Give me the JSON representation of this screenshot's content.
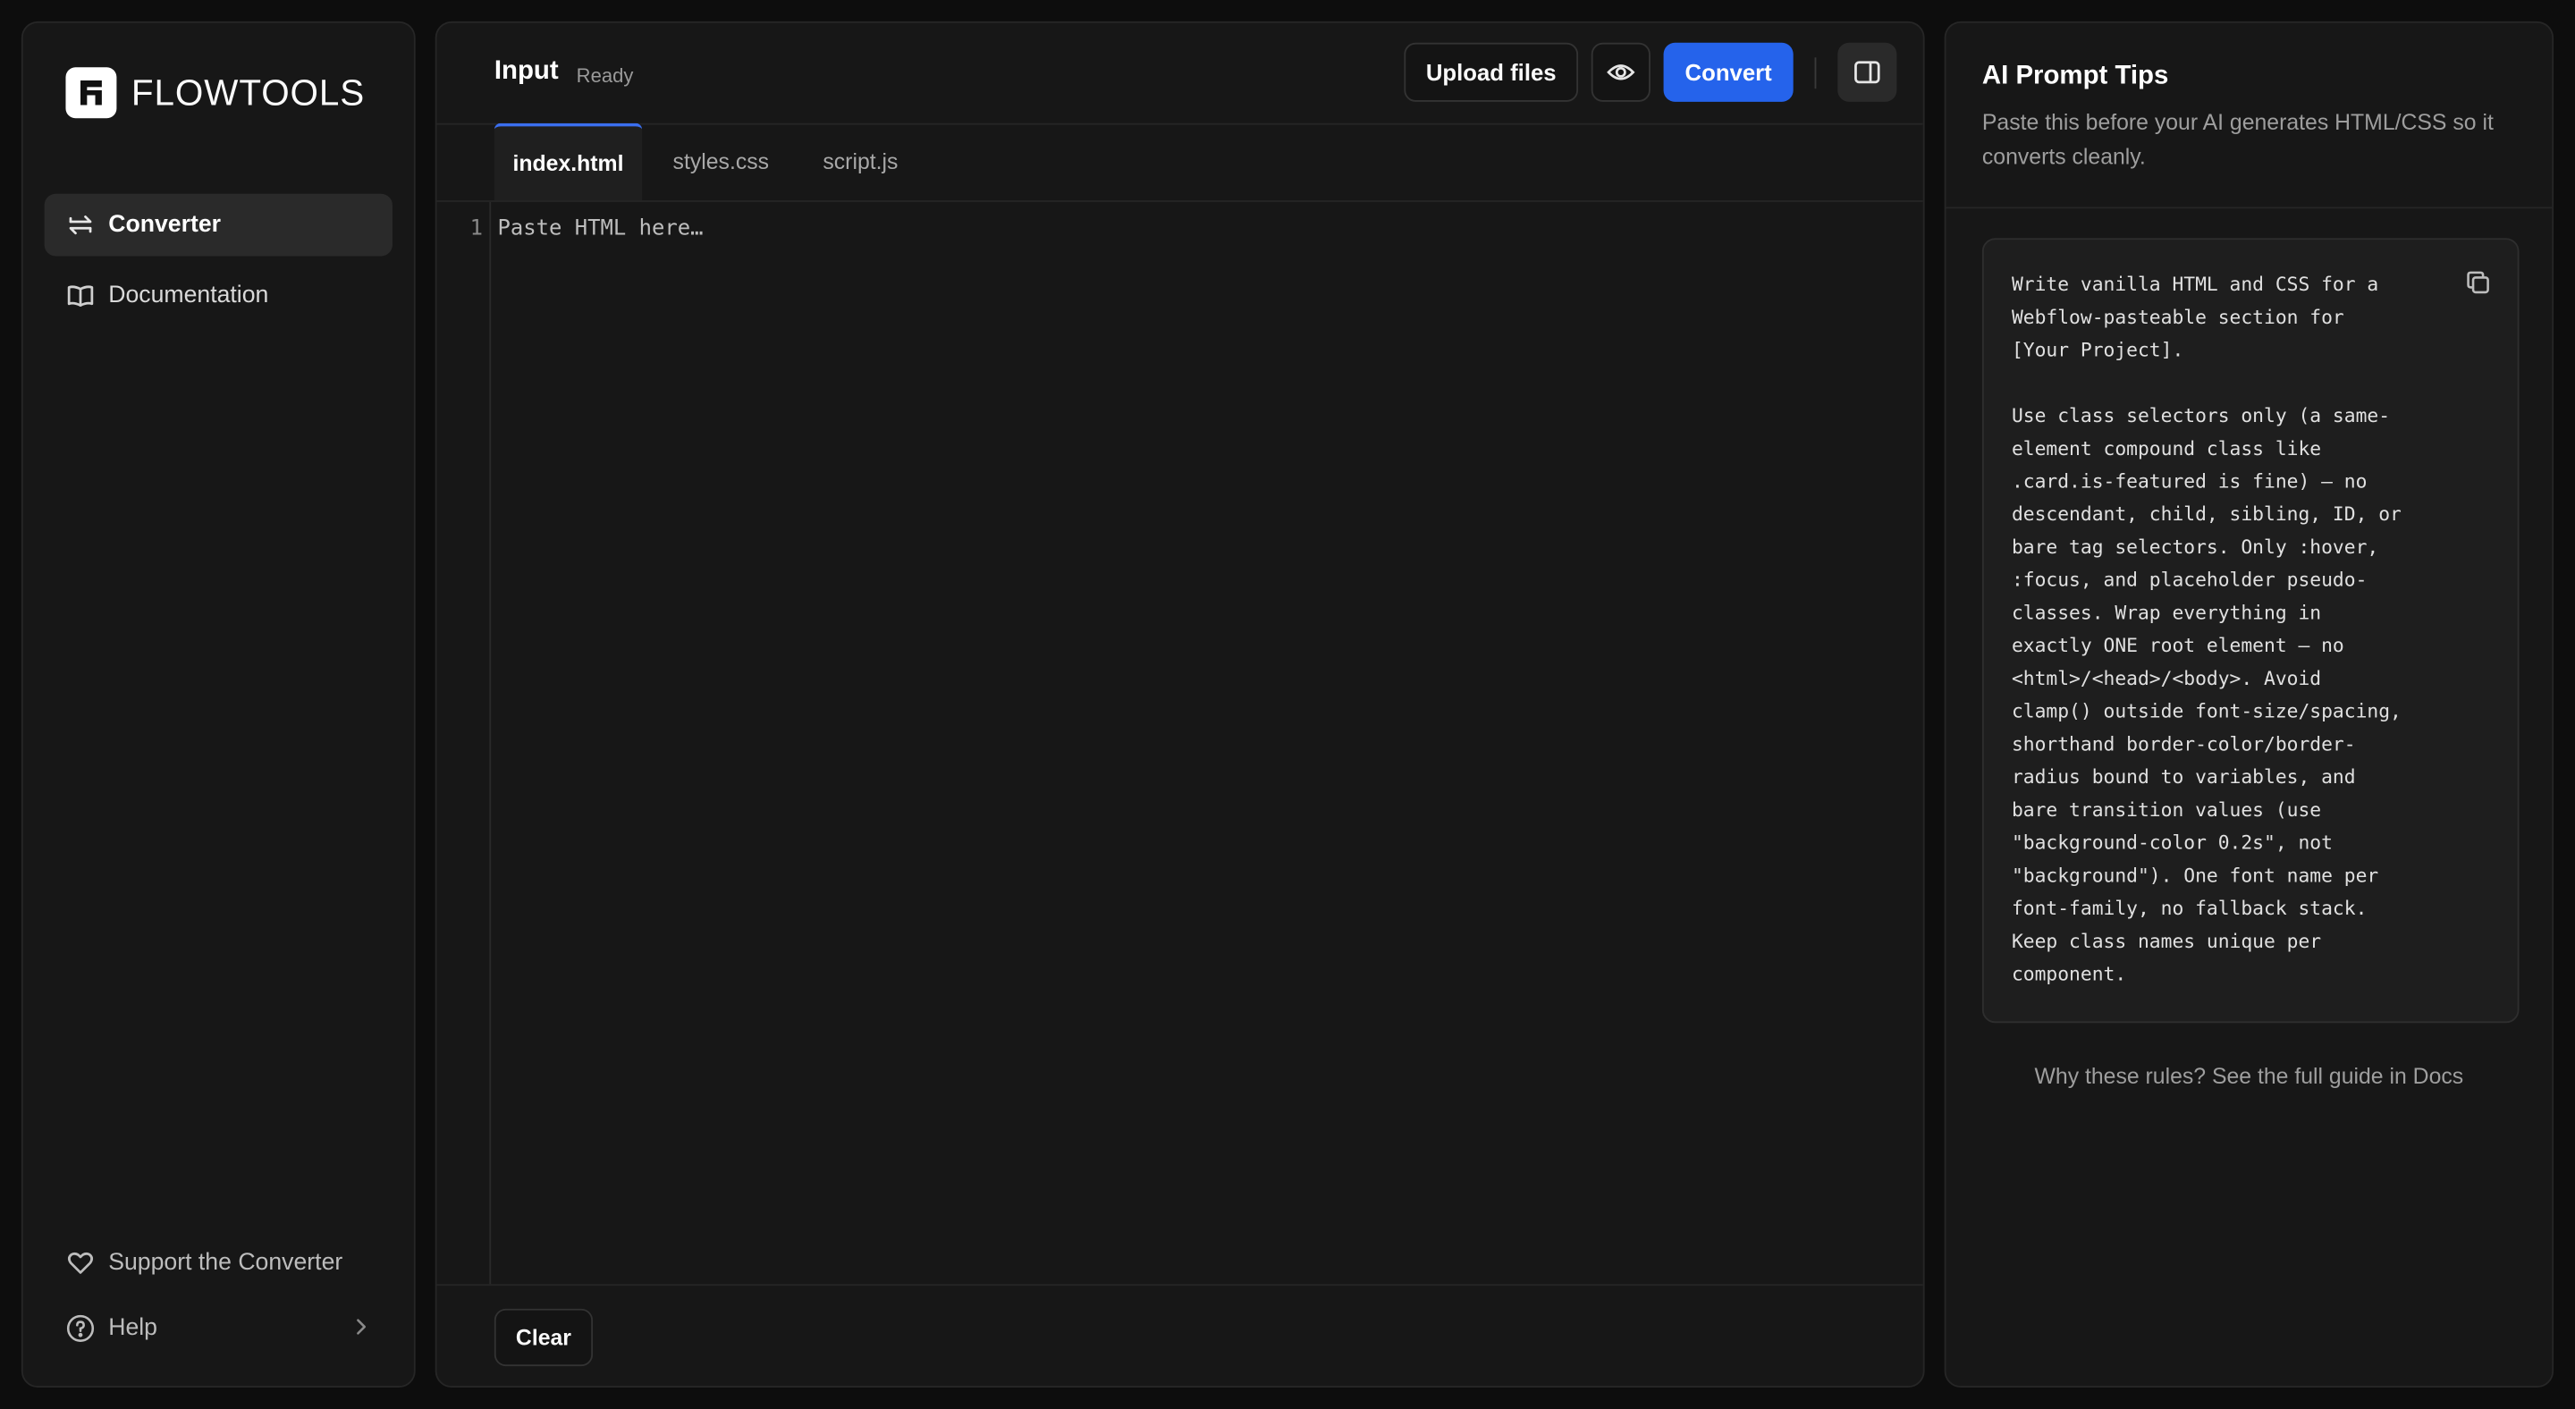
{
  "app": {
    "brand": "FLOWTOOLS"
  },
  "sidebar": {
    "items": [
      {
        "label": "Converter",
        "icon": "arrows-swap-icon",
        "active": true
      },
      {
        "label": "Documentation",
        "icon": "book-icon",
        "active": false
      }
    ],
    "footer": [
      {
        "label": "Support the Converter",
        "icon": "heart-icon"
      },
      {
        "label": "Help",
        "icon": "question-circle-icon"
      }
    ]
  },
  "editor": {
    "title": "Input",
    "status": "Ready",
    "buttons": {
      "upload": "Upload files",
      "convert": "Convert",
      "clear": "Clear"
    },
    "icons": {
      "preview": "eye-icon",
      "panel": "panel-right-icon"
    },
    "tabs": [
      {
        "label": "index.html",
        "active": true
      },
      {
        "label": "styles.css",
        "active": false
      },
      {
        "label": "script.js",
        "active": false
      }
    ],
    "line_number": "1",
    "placeholder": "Paste HTML here…"
  },
  "tips": {
    "title": "AI Prompt Tips",
    "subtitle": "Paste this before your AI generates HTML/CSS so it converts cleanly.",
    "prompt": "Write vanilla HTML and CSS for a\nWebflow-pasteable section for\n[Your Project].\n\nUse class selectors only (a same-\nelement compound class like\n.card.is-featured is fine) — no\ndescendant, child, sibling, ID, or\nbare tag selectors. Only :hover,\n:focus, and placeholder pseudo-\nclasses. Wrap everything in\nexactly ONE root element — no\n<html>/<head>/<body>. Avoid\nclamp() outside font-size/spacing,\nshorthand border-color/border-\nradius bound to variables, and\nbare transition values (use\n\"background-color 0.2s\", not\n\"background\"). One font name per\nfont-family, no fallback stack.\nKeep class names unique per\ncomponent.",
    "footer_link": "Why these rules? See the full guide in Docs",
    "copy_icon": "copy-icon"
  },
  "colors": {
    "background": "#0d0d0d",
    "panel": "#171717",
    "accent": "#2563eb",
    "active_tab_border": "#3b6ff0"
  }
}
